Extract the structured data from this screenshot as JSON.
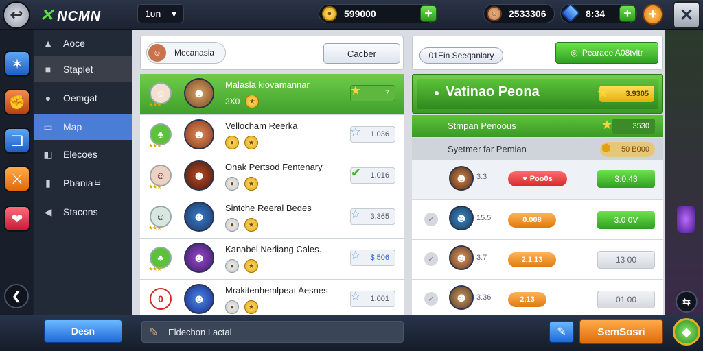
{
  "topbar": {
    "back_icon": "home-back-icon",
    "logo_text": "NCMN",
    "dropdown_value": "1ᴜn",
    "coins": "599000",
    "gems_icon": "character-icon",
    "player_value": "2533306",
    "crystal_value": "8:34"
  },
  "sidebar_icons": [
    "star-icon",
    "fist-icon",
    "cards-icon",
    "sword-icon",
    "chat-icon"
  ],
  "nav": {
    "items": [
      {
        "icon": "▲",
        "label": "Aᴏce"
      },
      {
        "icon": "■",
        "label": "Staplet"
      },
      {
        "icon": "●",
        "label": "Oemgat"
      },
      {
        "icon": "▭",
        "label": "Map"
      },
      {
        "icon": "◧",
        "label": "Elecoes"
      },
      {
        "icon": "▮",
        "label": "Pbaniaㅂ"
      },
      {
        "icon": "◀",
        "label": "Stacons"
      }
    ]
  },
  "left_panel": {
    "search_label": "Mecanasia",
    "action_button": "Cacber",
    "rows": [
      {
        "title": "Malasla kiovamannar",
        "sub": "3X0",
        "value": "7",
        "icon": "★"
      },
      {
        "title": "Vellocham Reerka",
        "sub": "",
        "value": "1.036",
        "icon": "☆"
      },
      {
        "title": "Onak Pertsod Fentenary",
        "sub": "",
        "value": "1.016",
        "icon": "✔"
      },
      {
        "title": "Sintche Reeral Bedes",
        "sub": "",
        "value": "3.365",
        "icon": "☆"
      },
      {
        "title": "Kanabel  Nerliang Cales.",
        "sub": "",
        "value": "$ 506",
        "icon": "☆"
      },
      {
        "title": "Mrakitenhemlpeat Aesnes",
        "sub": "",
        "value": "1.001",
        "icon": "☆"
      }
    ]
  },
  "right_panel": {
    "filter_label": "01Ein Seeqanlary",
    "promo_button": "Pearaee A08tvltr",
    "header_title": "Vatinao Peona",
    "header_value": "3.9305",
    "sub1_label": "Stmpan Penoous",
    "sub1_value": "3530",
    "sub2_label": "Syetmer far Pemian",
    "sub2_value": "50 B000",
    "rows": [
      {
        "num": "3.3",
        "chip": "Poo0s",
        "btn": "3.0.43"
      },
      {
        "num": "15.5",
        "chip": "0.008",
        "btn": "3.0 0V"
      },
      {
        "num": "3.7",
        "chip": "2.1.13",
        "btn": "13 00"
      },
      {
        "num": "3.36",
        "chip": "2.13",
        "btn": "01 00"
      }
    ]
  },
  "bottombar": {
    "left_button": "Desn",
    "status_text": "Eldechon Lactal",
    "right_button": "SemSosri"
  }
}
